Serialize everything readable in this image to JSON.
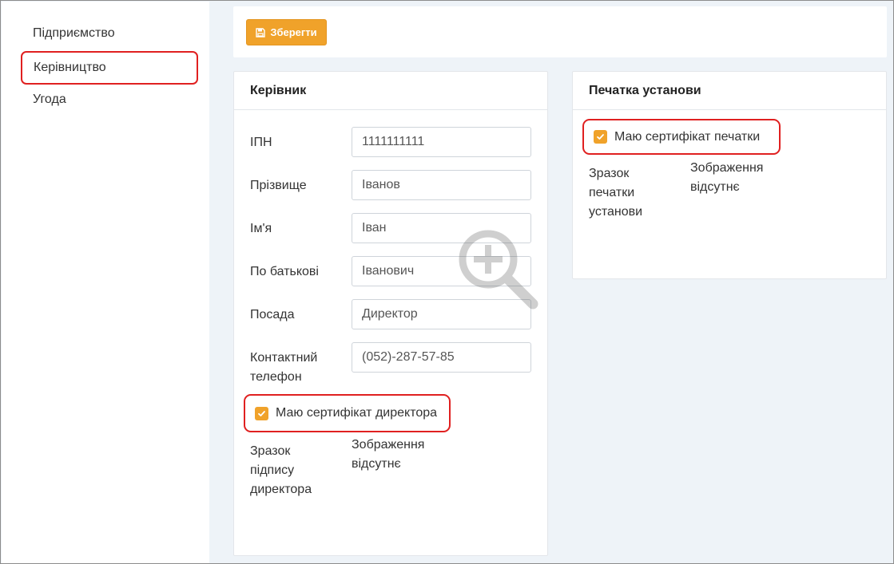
{
  "sidebar": {
    "items": [
      {
        "label": "Підприємство"
      },
      {
        "label": "Керівництво"
      },
      {
        "label": "Угода"
      }
    ]
  },
  "toolbar": {
    "save_label": "Зберегти",
    "save_icon": "floppy-disk-icon"
  },
  "director_card": {
    "title": "Керівник",
    "fields": [
      {
        "label": "ІПН",
        "value": "1111111111"
      },
      {
        "label": "Прізвище",
        "value": "Іванов"
      },
      {
        "label": "Ім'я",
        "value": "Іван"
      },
      {
        "label": "По батькові",
        "value": "Іванович"
      },
      {
        "label": "Посада",
        "value": "Директор"
      },
      {
        "label": "Контактний телефон",
        "value": "(052)-287-57-85"
      }
    ],
    "certificate_label": "Маю сертифікат директора",
    "certificate_checked": true,
    "sample_label": "Зразок підпису директора",
    "no_image_text": "Зображення відсутнє"
  },
  "seal_card": {
    "title": "Печатка установи",
    "certificate_label": "Маю сертифікат печатки",
    "certificate_checked": true,
    "sample_label": "Зразок печатки установи",
    "no_image_text": "Зображення відсутнє"
  },
  "colors": {
    "accent": "#f0a22a",
    "highlight": "#e02020",
    "background": "#eef3f8"
  },
  "overlay_icon": "zoom-in-icon"
}
